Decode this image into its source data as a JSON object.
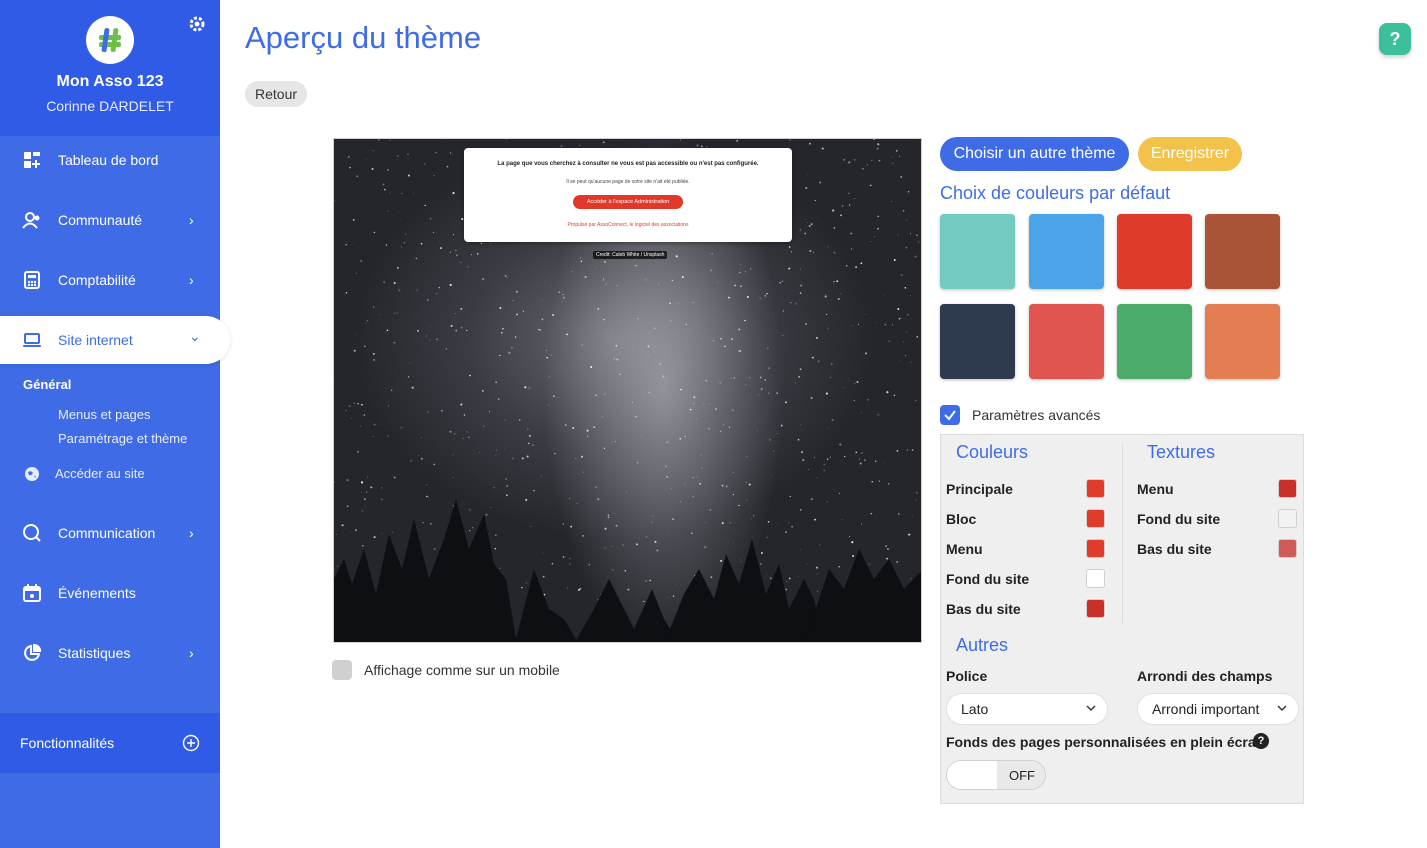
{
  "sidebar": {
    "asso_name": "Mon Asso 123",
    "user_name": "Corinne DARDELET",
    "items": [
      {
        "label": "Tableau de bord",
        "icon": "dashboard-icon"
      },
      {
        "label": "Communauté",
        "icon": "community-icon",
        "chevron": "›"
      },
      {
        "label": "Comptabilité",
        "icon": "calculator-icon",
        "chevron": "›"
      },
      {
        "label": "Site internet",
        "icon": "laptop-icon",
        "chevron": "⌄",
        "active": true
      },
      {
        "label": "Communication",
        "icon": "chat-icon",
        "chevron": "›"
      },
      {
        "label": "Événements",
        "icon": "calendar-icon"
      },
      {
        "label": "Statistiques",
        "icon": "chart-pie-icon",
        "chevron": "›"
      }
    ],
    "submenu": {
      "title": "Général",
      "links": [
        "Menus et pages",
        "Paramétrage et thème"
      ],
      "access_site": "Accéder au site"
    },
    "features": "Fonctionnalités"
  },
  "header": {
    "title": "Aperçu du thème",
    "back_label": "Retour",
    "help_label": "?"
  },
  "preview": {
    "card_title": "La page que vous cherchez à consulter ne vous est pas accessible ou n'est pas configurée.",
    "card_text": "Il se peut qu'aucune page de votre site n'ait été publiée.",
    "card_button": "Accéder à l'espace Administration",
    "card_footer": "Propulsé par AssoConnect, le logiciel des associations",
    "credit": "Credit: Caleb White / Unsplash",
    "mobile_label": "Affichage comme sur un mobile"
  },
  "theme": {
    "choose_label": "Choisir un autre thème",
    "save_label": "Enregistrer",
    "default_colors_title": "Choix de couleurs par défaut",
    "swatches": [
      "#73cbc0",
      "#4ba3e8",
      "#de3b2b",
      "#a95436",
      "#2e3a4d",
      "#e05550",
      "#4bab69",
      "#e57d52"
    ],
    "advanced_label": "Paramètres avancés",
    "advanced_checked": true
  },
  "advanced": {
    "colors_title": "Couleurs",
    "colors": [
      {
        "label": "Principale",
        "color": "#e03b2b"
      },
      {
        "label": "Bloc",
        "color": "#e03b2b"
      },
      {
        "label": "Menu",
        "color": "#e03b2b"
      },
      {
        "label": "Fond du site",
        "color": "#ffffff"
      },
      {
        "label": "Bas du site",
        "color": "#c9302a"
      }
    ],
    "textures_title": "Textures",
    "textures": [
      {
        "label": "Menu",
        "color": "#c9302a"
      },
      {
        "label": "Fond du site",
        "color": "#f2f2f2"
      },
      {
        "label": "Bas du site",
        "color": "#cf5a57"
      }
    ],
    "others_title": "Autres",
    "font_label": "Police",
    "font_value": "Lato",
    "rounding_label": "Arrondi des champs",
    "rounding_value": "Arrondi important",
    "fullscreen_label": "Fonds des pages personnalisées en plein écran",
    "toggle_label": "OFF"
  }
}
